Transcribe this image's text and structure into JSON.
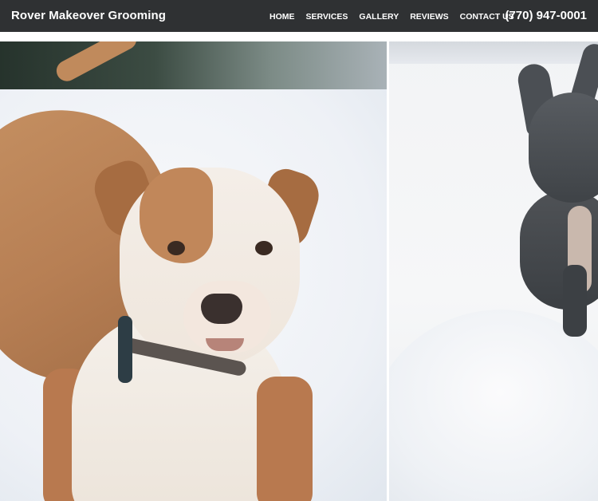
{
  "header": {
    "brand": "Rover Makeover Grooming",
    "nav": [
      "HOME",
      "SERVICES",
      "GALLERY",
      "REVIEWS",
      "CONTACT US"
    ],
    "phone": "(770) 947-0001"
  }
}
